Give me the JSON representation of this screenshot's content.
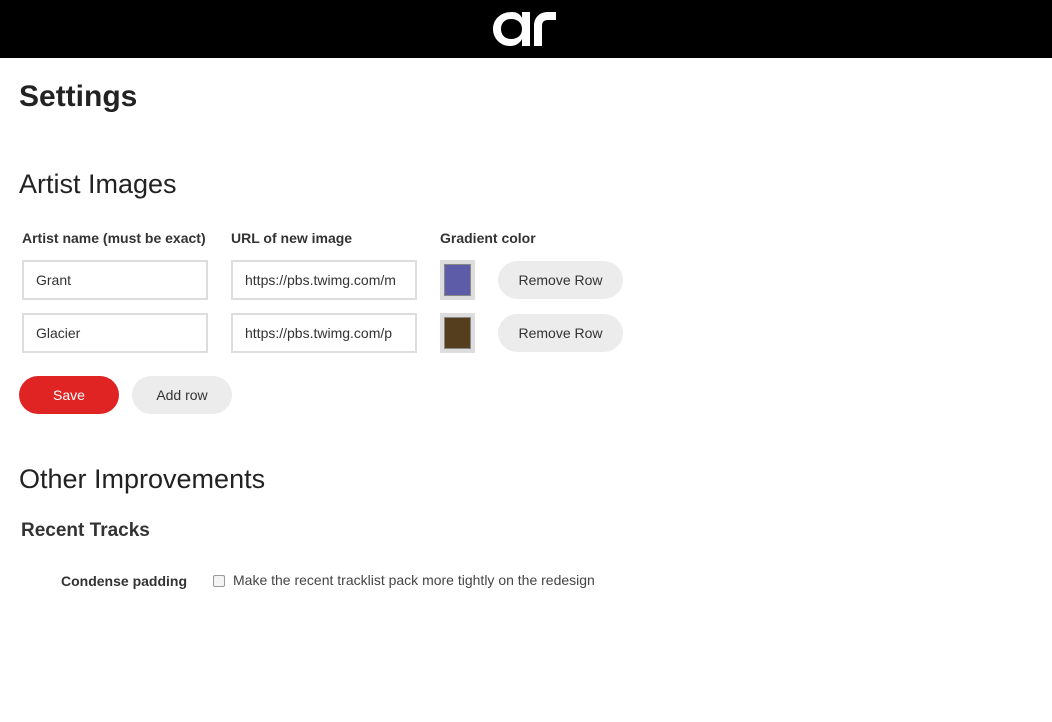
{
  "header": {
    "logo_icon": "ar-logo-icon"
  },
  "page": {
    "title": "Settings"
  },
  "artist_images": {
    "title": "Artist Images",
    "columns": [
      "Artist name (must be exact)",
      "URL of new image",
      "Gradient color"
    ],
    "rows": [
      {
        "artist": "Grant",
        "url": "https://pbs.twimg.com/m",
        "color": "#5c5ca8",
        "remove_label": "Remove Row"
      },
      {
        "artist": "Glacier",
        "url": "https://pbs.twimg.com/p",
        "color": "#553e1e",
        "remove_label": "Remove Row"
      }
    ],
    "save_label": "Save",
    "add_label": "Add row"
  },
  "other": {
    "title": "Other Improvements",
    "subsection": "Recent Tracks",
    "option": {
      "label": "Condense padding",
      "description": "Make the recent tracklist pack more tightly on the redesign",
      "checked": false
    }
  },
  "colors": {
    "accent": "#e02424",
    "topbar": "#000000"
  }
}
